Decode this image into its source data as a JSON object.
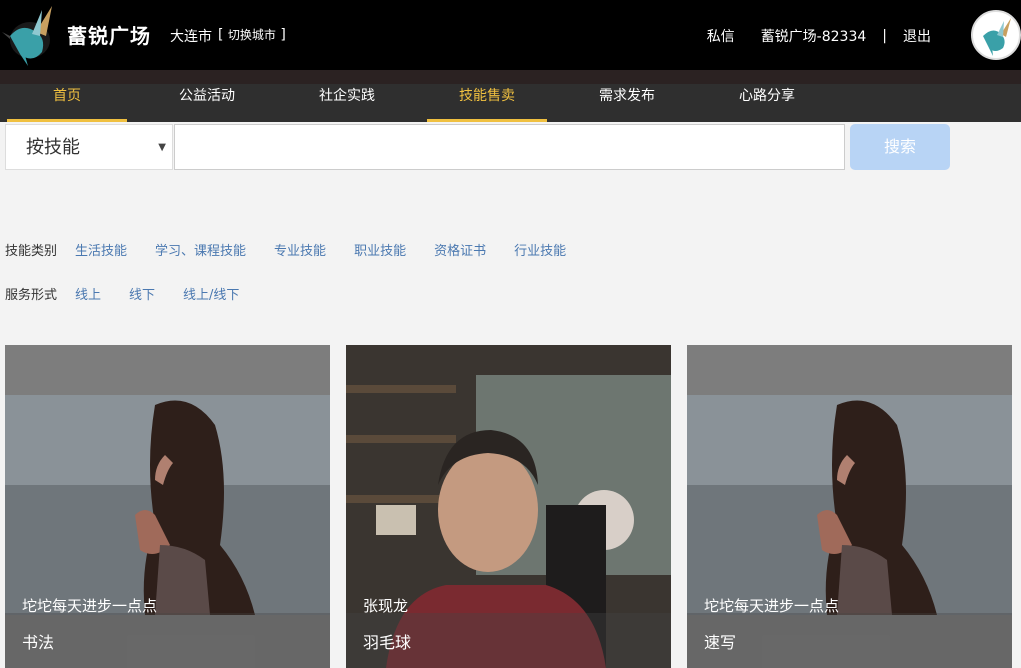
{
  "header": {
    "brand": "蓄锐广场",
    "city": "大连市",
    "switch_city": "切换城市",
    "messages": "私信",
    "username": "蓄锐广场-82334",
    "separator": "|",
    "logout": "退出"
  },
  "nav": {
    "items": [
      {
        "label": "首页",
        "active": true
      },
      {
        "label": "公益活动",
        "active": false
      },
      {
        "label": "社企实践",
        "active": false
      },
      {
        "label": "技能售卖",
        "active": true
      },
      {
        "label": "需求发布",
        "active": false
      },
      {
        "label": "心路分享",
        "active": false
      }
    ]
  },
  "search": {
    "select_value": "按技能",
    "input_value": "",
    "button": "搜索"
  },
  "filters": {
    "category_label": "技能类别",
    "categories": [
      "生活技能",
      "学习、课程技能",
      "专业技能",
      "职业技能",
      "资格证书",
      "行业技能"
    ],
    "service_label": "服务形式",
    "services": [
      "线上",
      "线下",
      "线上/线下"
    ]
  },
  "cards": [
    {
      "name": "坨坨每天进步一点点",
      "skill": "书法"
    },
    {
      "name": "张现龙",
      "skill": "羽毛球"
    },
    {
      "name": "坨坨每天进步一点点",
      "skill": "速写"
    }
  ],
  "colors": {
    "accent": "#f0c040",
    "link": "#4a78b0",
    "search_button": "#b8d4f5",
    "header_bg": "#000000",
    "nav_bg": "#2f2f2f"
  }
}
